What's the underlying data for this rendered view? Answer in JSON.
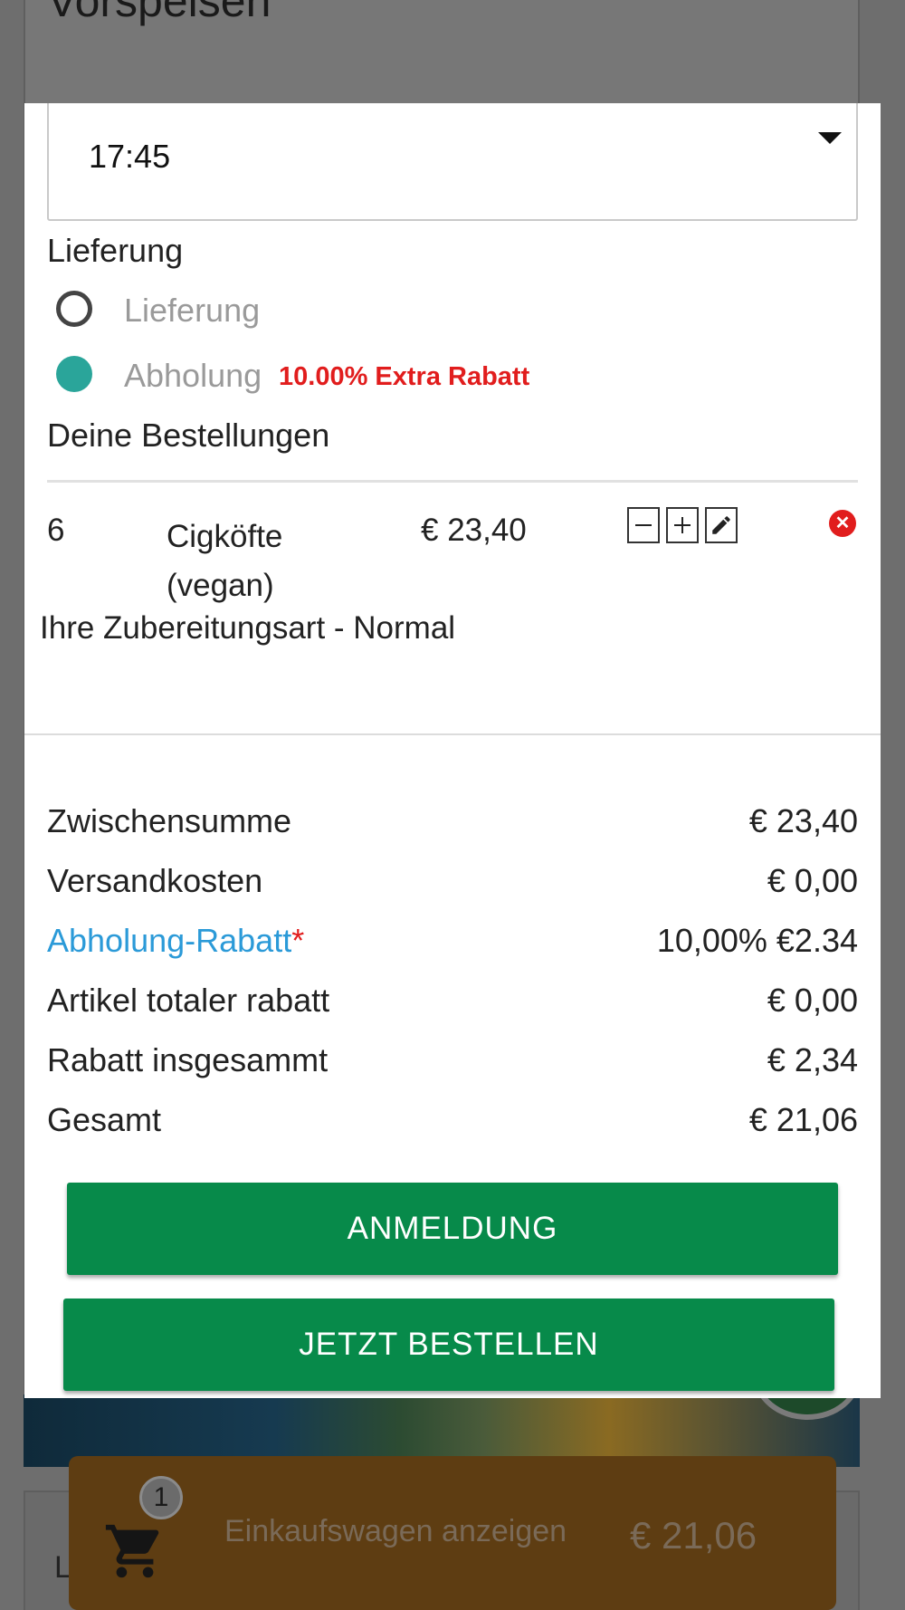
{
  "background": {
    "section_title": "Vorspeisen",
    "partial_letter": "L"
  },
  "modal": {
    "time_select": {
      "value": "17:45"
    },
    "delivery": {
      "section_label": "Lieferung",
      "options": [
        {
          "label": "Lieferung",
          "selected": false
        },
        {
          "label": "Abholung",
          "selected": true
        }
      ],
      "extra_discount": "10.00% Extra Rabatt"
    },
    "orders": {
      "section_label": "Deine Bestellungen",
      "items": [
        {
          "qty": "6",
          "name": "Cigköfte (vegan)",
          "price": "€ 23,40",
          "preparation": "Ihre Zubereitungsart - Normal"
        }
      ]
    },
    "summary": {
      "subtotal": {
        "label": "Zwischensumme",
        "value": "€ 23,40"
      },
      "shipping": {
        "label": "Versandkosten",
        "value": "€ 0,00"
      },
      "pickup_discount": {
        "label": "Abholung-Rabatt",
        "marker": "*",
        "value": "10,00% €2.34"
      },
      "item_discount": {
        "label": "Artikel totaler rabatt",
        "value": "€ 0,00"
      },
      "total_discount": {
        "label": "Rabatt insgesammt",
        "value": "€ 2,34"
      },
      "total": {
        "label": "Gesamt",
        "value": "€ 21,06"
      }
    },
    "buttons": {
      "login": "ANMELDUNG",
      "order_now": "JETZT BESTELLEN"
    }
  },
  "cart_bar": {
    "badge_count": "1",
    "label": "Einkaufswagen anzeigen",
    "total": "€ 21,06"
  },
  "colors": {
    "primary_green": "#078a4a",
    "radio_selected": "#2aa59a",
    "discount_red": "#e11d1d",
    "link_blue": "#2b9ad8"
  },
  "icons": {
    "select_caret": "caret-down-icon",
    "minus": "minus-icon",
    "plus": "plus-icon",
    "edit": "pencil-icon",
    "remove": "close-circle-icon",
    "cart": "shopping-cart-icon"
  }
}
